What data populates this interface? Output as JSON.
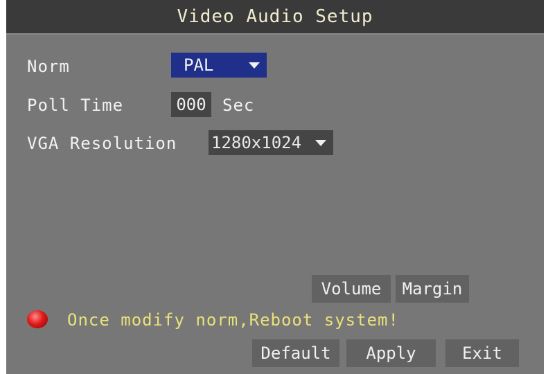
{
  "title": "Video Audio Setup",
  "fields": {
    "norm": {
      "label": "Norm",
      "value": "PAL"
    },
    "poll_time": {
      "label": "Poll Time",
      "value": "000",
      "unit": "Sec"
    },
    "vga_resolution": {
      "label": "VGA Resolution",
      "value": "1280x1024"
    }
  },
  "buttons": {
    "volume": "Volume",
    "margin": "Margin",
    "default": "Default",
    "apply": "Apply",
    "exit": "Exit"
  },
  "warning": "Once modify norm,Reboot system!",
  "colors": {
    "panel": "#777777",
    "title_bar": "#3a3a3a",
    "selected": "#1f2f8a",
    "warning_text": "#e9e27a",
    "led": "#e01a1a"
  }
}
